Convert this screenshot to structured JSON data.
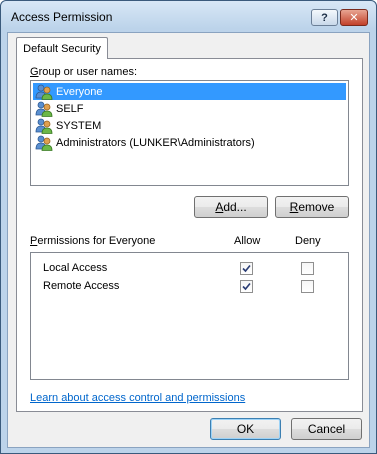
{
  "window": {
    "title": "Access Permission",
    "help_label": "?",
    "close_label": "✕"
  },
  "tab": {
    "label": "Default Security"
  },
  "group_list": {
    "label_prefix": "G",
    "label_rest": "roup or user names:",
    "items": [
      {
        "label": "Everyone",
        "icon": "users-icon",
        "selected": true
      },
      {
        "label": "SELF",
        "icon": "users-icon",
        "selected": false
      },
      {
        "label": "SYSTEM",
        "icon": "users-icon",
        "selected": false
      },
      {
        "label": "Administrators (LUNKER\\Administrators)",
        "icon": "users-icon",
        "selected": false
      }
    ]
  },
  "buttons": {
    "add_prefix": "A",
    "add_rest": "dd...",
    "remove_prefix": "R",
    "remove_rest": "emove",
    "ok": "OK",
    "cancel": "Cancel"
  },
  "permissions": {
    "header_prefix": "P",
    "header_rest": "ermissions for Everyone",
    "allow_label": "Allow",
    "deny_label": "Deny",
    "rows": [
      {
        "label": "Local Access",
        "allow": true,
        "deny": false
      },
      {
        "label": "Remote Access",
        "allow": true,
        "deny": false
      }
    ]
  },
  "link": {
    "label": "Learn about access control and permissions"
  },
  "colors": {
    "selection": "#3399ff",
    "link": "#0066cc",
    "title_bar": "#bcd3ea"
  }
}
